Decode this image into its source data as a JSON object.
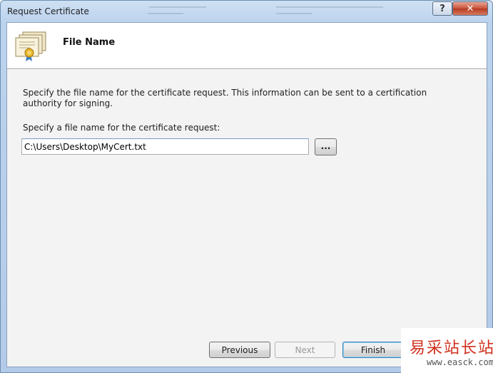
{
  "window": {
    "title": "Request Certificate",
    "help_label": "?",
    "close_label": "✕"
  },
  "header": {
    "icon": "certificate-icon",
    "title": "File Name"
  },
  "body": {
    "description": "Specify the file name for the certificate request. This information can be sent to a certification authority for signing.",
    "field_label": "Specify a file name for the certificate request:",
    "file_value": "C:\\Users\\Desktop\\MyCert.txt",
    "browse_label": "..."
  },
  "footer": {
    "previous_label": "Previous",
    "next_label": "Next",
    "finish_label": "Finish"
  },
  "watermark": {
    "chinese": "易采站长站",
    "url": "www.easck.com"
  },
  "colors": {
    "titlebar": "#bcd3ee",
    "close_button": "#c8513a",
    "focus_border": "#3c7fb1",
    "watermark_red": "#d0301e"
  }
}
